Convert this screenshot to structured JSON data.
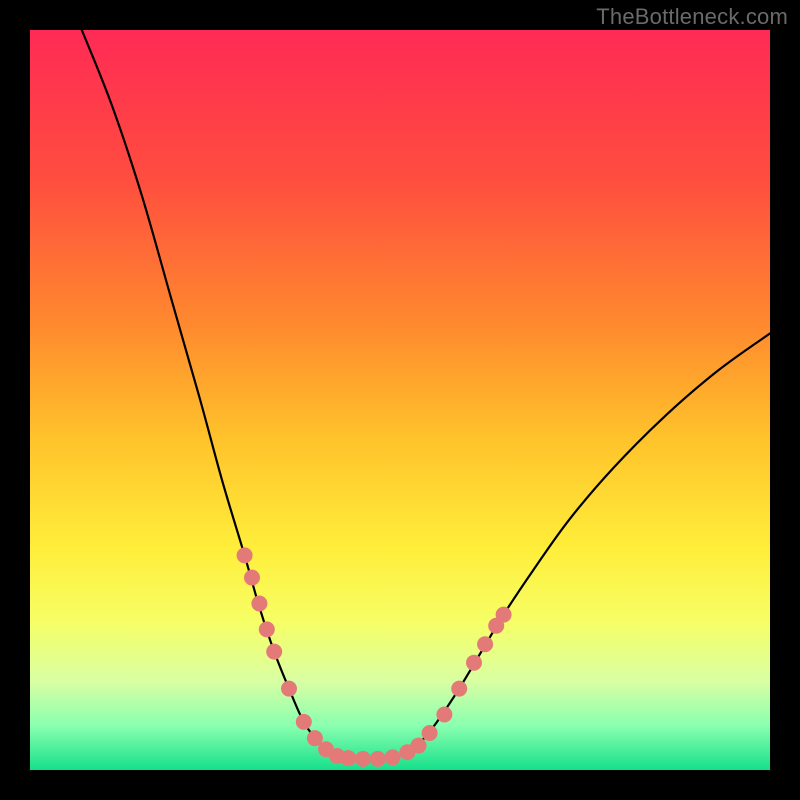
{
  "watermark": "TheBottleneck.com",
  "chart_data": {
    "type": "line",
    "title": "",
    "xlabel": "",
    "ylabel": "",
    "xlim": [
      0,
      100
    ],
    "ylim": [
      0,
      100
    ],
    "grid": false,
    "legend": false,
    "background_gradient_stops": [
      {
        "offset": 0.0,
        "color": "#ff2a55"
      },
      {
        "offset": 0.2,
        "color": "#ff4d3f"
      },
      {
        "offset": 0.4,
        "color": "#ff8a2e"
      },
      {
        "offset": 0.55,
        "color": "#ffc22b"
      },
      {
        "offset": 0.7,
        "color": "#ffee3a"
      },
      {
        "offset": 0.8,
        "color": "#f6ff66"
      },
      {
        "offset": 0.88,
        "color": "#d9ffa3"
      },
      {
        "offset": 0.94,
        "color": "#8affb0"
      },
      {
        "offset": 1.0,
        "color": "#15e08a"
      }
    ],
    "series": [
      {
        "name": "curve",
        "stroke": "#000000",
        "stroke_width": 2.2,
        "data": [
          {
            "x": 7.0,
            "y": 100.0
          },
          {
            "x": 11.0,
            "y": 90.0
          },
          {
            "x": 15.0,
            "y": 78.0
          },
          {
            "x": 19.0,
            "y": 64.0
          },
          {
            "x": 23.0,
            "y": 50.0
          },
          {
            "x": 26.0,
            "y": 39.0
          },
          {
            "x": 29.0,
            "y": 29.0
          },
          {
            "x": 31.0,
            "y": 22.0
          },
          {
            "x": 33.0,
            "y": 16.0
          },
          {
            "x": 35.0,
            "y": 11.0
          },
          {
            "x": 37.0,
            "y": 6.5
          },
          {
            "x": 39.0,
            "y": 3.8
          },
          {
            "x": 41.0,
            "y": 2.2
          },
          {
            "x": 43.0,
            "y": 1.6
          },
          {
            "x": 45.0,
            "y": 1.5
          },
          {
            "x": 47.0,
            "y": 1.5
          },
          {
            "x": 49.0,
            "y": 1.7
          },
          {
            "x": 51.0,
            "y": 2.4
          },
          {
            "x": 53.0,
            "y": 4.0
          },
          {
            "x": 55.0,
            "y": 6.5
          },
          {
            "x": 58.0,
            "y": 11.0
          },
          {
            "x": 61.0,
            "y": 16.0
          },
          {
            "x": 64.0,
            "y": 21.0
          },
          {
            "x": 68.0,
            "y": 27.0
          },
          {
            "x": 73.0,
            "y": 34.0
          },
          {
            "x": 79.0,
            "y": 41.0
          },
          {
            "x": 86.0,
            "y": 48.0
          },
          {
            "x": 93.0,
            "y": 54.0
          },
          {
            "x": 100.0,
            "y": 59.0
          }
        ]
      },
      {
        "name": "dots",
        "fill": "#e47a78",
        "radius": 8,
        "data": [
          {
            "x": 29.0,
            "y": 29.0
          },
          {
            "x": 30.0,
            "y": 26.0
          },
          {
            "x": 31.0,
            "y": 22.5
          },
          {
            "x": 32.0,
            "y": 19.0
          },
          {
            "x": 33.0,
            "y": 16.0
          },
          {
            "x": 35.0,
            "y": 11.0
          },
          {
            "x": 37.0,
            "y": 6.5
          },
          {
            "x": 38.5,
            "y": 4.3
          },
          {
            "x": 40.0,
            "y": 2.8
          },
          {
            "x": 41.5,
            "y": 1.9
          },
          {
            "x": 43.0,
            "y": 1.6
          },
          {
            "x": 45.0,
            "y": 1.5
          },
          {
            "x": 47.0,
            "y": 1.5
          },
          {
            "x": 49.0,
            "y": 1.7
          },
          {
            "x": 51.0,
            "y": 2.4
          },
          {
            "x": 52.5,
            "y": 3.3
          },
          {
            "x": 54.0,
            "y": 5.0
          },
          {
            "x": 56.0,
            "y": 7.5
          },
          {
            "x": 58.0,
            "y": 11.0
          },
          {
            "x": 60.0,
            "y": 14.5
          },
          {
            "x": 61.5,
            "y": 17.0
          },
          {
            "x": 63.0,
            "y": 19.5
          },
          {
            "x": 64.0,
            "y": 21.0
          }
        ]
      }
    ]
  }
}
